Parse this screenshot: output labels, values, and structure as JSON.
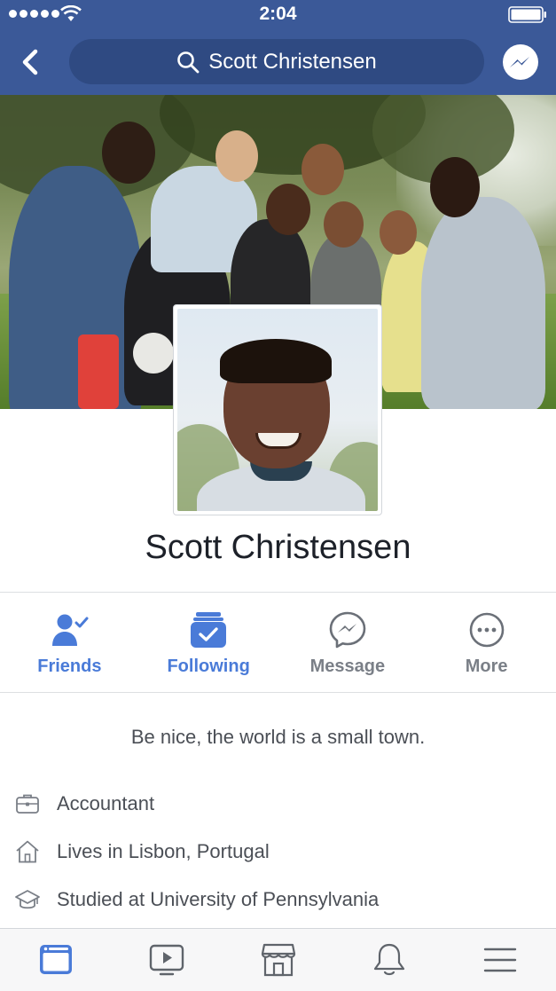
{
  "status_bar": {
    "time": "2:04"
  },
  "nav": {
    "back_icon": "chevron-left-icon",
    "search_query": "Scott Christensen",
    "messenger_icon": "messenger-icon"
  },
  "colors": {
    "header_bg": "#3b5998",
    "accent_blue": "#4a7bd8",
    "text_dark": "#1d2129",
    "text_muted": "#4b4f56"
  },
  "profile": {
    "name": "Scott Christensen",
    "bio": "Be nice, the world is a small town."
  },
  "actions": [
    {
      "label": "Friends",
      "icon": "friends-check-icon",
      "active": true
    },
    {
      "label": "Following",
      "icon": "following-check-icon",
      "active": true
    },
    {
      "label": "Message",
      "icon": "messenger-icon",
      "active": false
    },
    {
      "label": "More",
      "icon": "more-dots-icon",
      "active": false
    }
  ],
  "intro": {
    "items": [
      {
        "icon": "briefcase-icon",
        "text": "Accountant"
      },
      {
        "icon": "home-icon",
        "text": "Lives in Lisbon, Portugal"
      },
      {
        "icon": "graduation-cap-icon",
        "text": "Studied at University of Pennsylvania"
      }
    ]
  },
  "tabbar": [
    {
      "icon": "news-feed-icon",
      "active": true
    },
    {
      "icon": "watch-video-icon",
      "active": false
    },
    {
      "icon": "marketplace-icon",
      "active": false
    },
    {
      "icon": "notifications-bell-icon",
      "active": false
    },
    {
      "icon": "menu-icon",
      "active": false
    }
  ]
}
